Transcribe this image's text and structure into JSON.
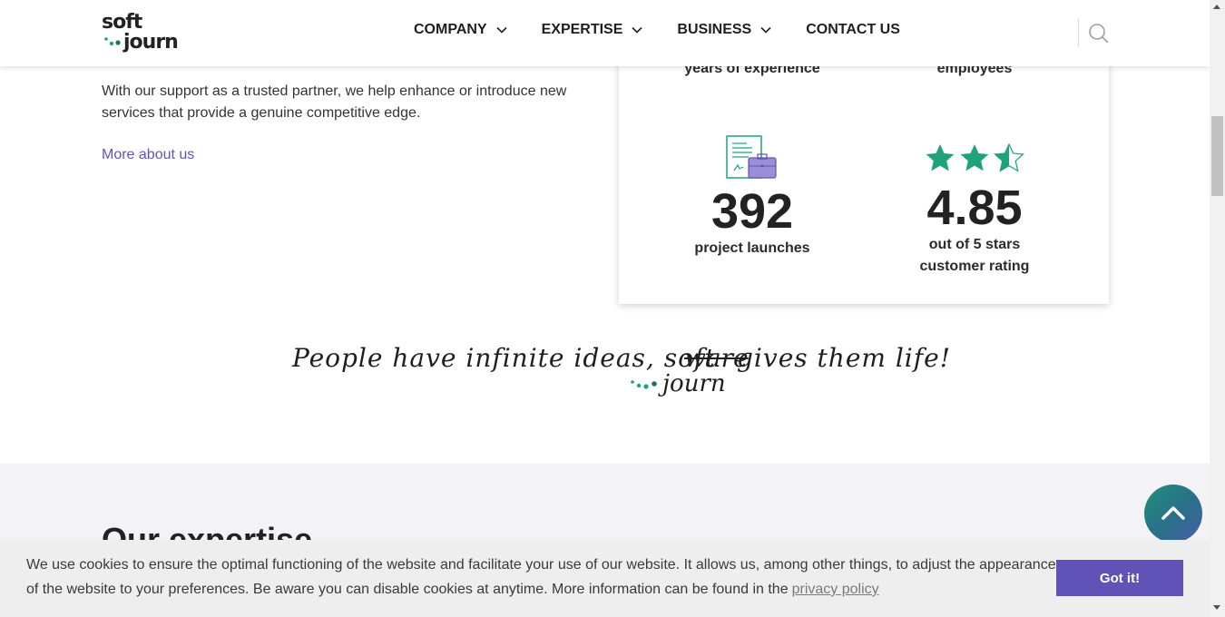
{
  "header": {
    "logo_top": "soft",
    "logo_bottom": "journ",
    "nav": [
      {
        "label": "COMPANY",
        "has_dropdown": true
      },
      {
        "label": "EXPERTISE",
        "has_dropdown": true
      },
      {
        "label": "BUSINESS",
        "has_dropdown": true
      },
      {
        "label": "CONTACT US",
        "has_dropdown": false
      }
    ],
    "search_icon": "search-icon"
  },
  "intro": {
    "text": "With our support as a trusted partner, we help enhance or introduce new services that provide a genuine competitive edge.",
    "link": "More about us"
  },
  "stats": {
    "years": {
      "label": "years of experience"
    },
    "employees": {
      "label": "employees"
    },
    "projects": {
      "value": "392",
      "label": "project launches",
      "icon": "document-briefcase-icon"
    },
    "rating": {
      "value": "4.85",
      "label_1": "out of 5 stars",
      "label_2": "customer rating",
      "stars": 2.5,
      "icon": "star-icon"
    }
  },
  "tagline": {
    "part1": "People have infinite ideas, soft",
    "struck": "ware",
    "part2": "gives them life!",
    "replacement": "journ"
  },
  "expertise": {
    "title": "Our expertise"
  },
  "cookie": {
    "text": "We use cookies to ensure the optimal functioning of the website and facilitate your use of our website. It allows us, among other things, to adjust the appearance of the website to your preferences. Be aware you can disable cookies at anytime. More information can be found in the",
    "link": "privacy policy",
    "button": "Got it!"
  },
  "colors": {
    "accent_purple": "#6152b8",
    "link_purple": "#5f55b6",
    "green": "#1ea37c"
  }
}
